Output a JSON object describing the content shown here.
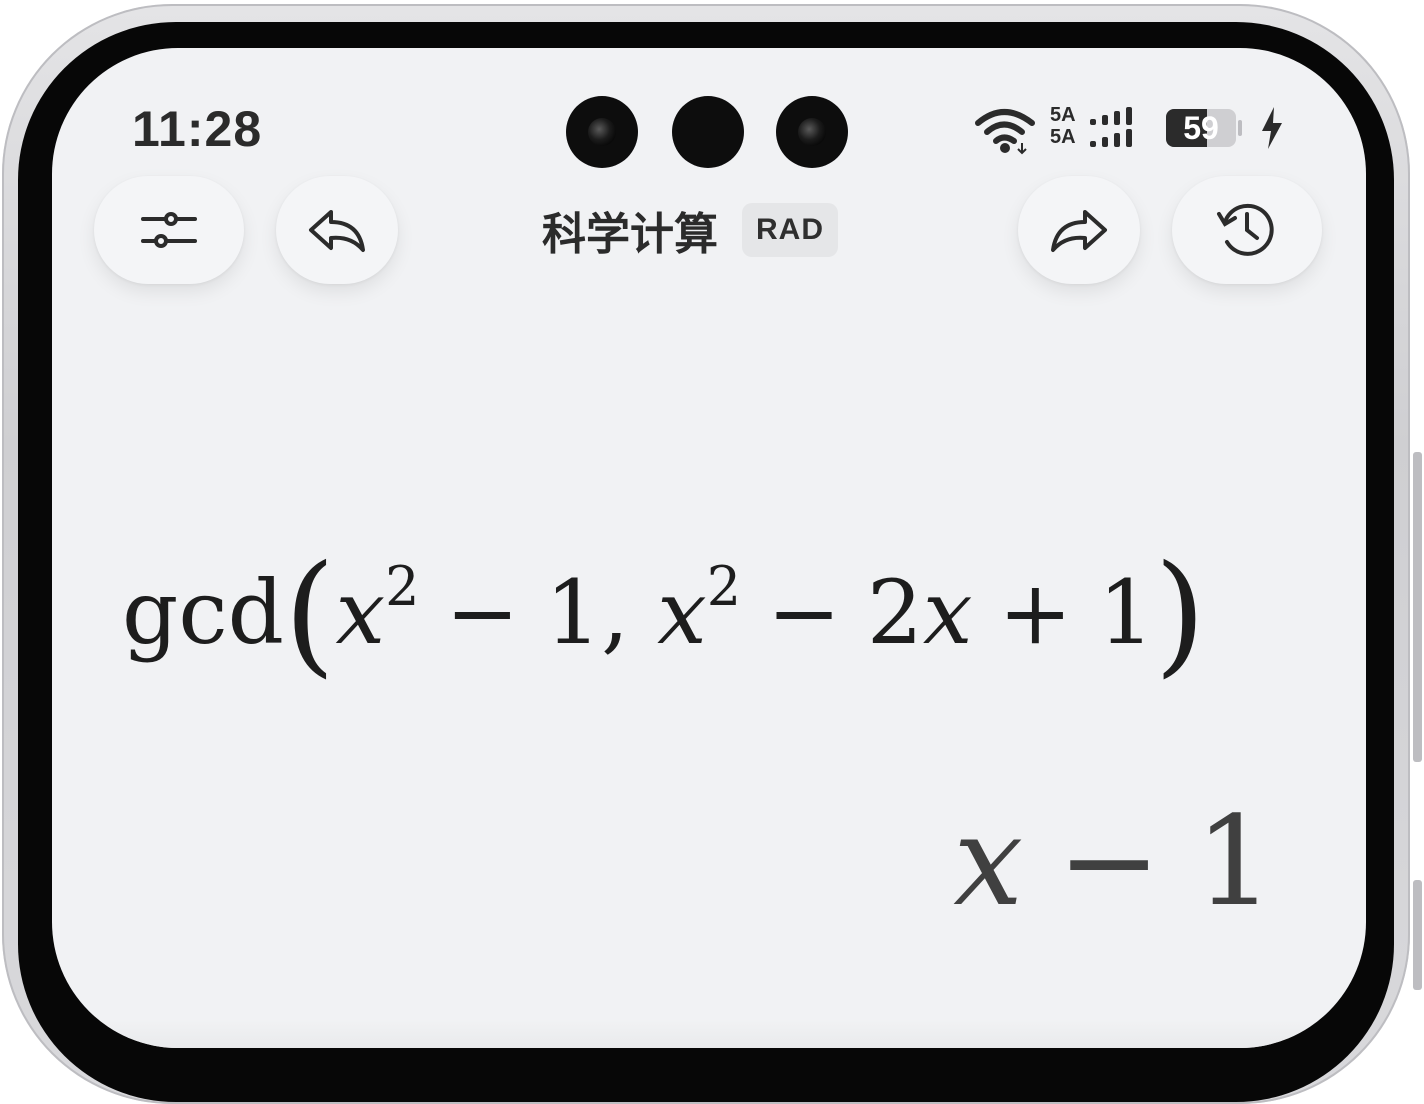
{
  "status_bar": {
    "time": "11:28",
    "network_top": "5A",
    "network_bottom": "5A",
    "battery_percent": "59",
    "battery_level": 0.59,
    "charging": true
  },
  "toolbar": {
    "title": "科学计算",
    "angle_mode": "RAD",
    "icons": [
      "sliders-icon",
      "undo-icon",
      "redo-icon",
      "history-icon"
    ]
  },
  "expression": {
    "function": "gcd",
    "open_paren": "(",
    "var1": "x",
    "exp1": "2",
    "minus1": "−",
    "const1": "1,",
    "var2": "x",
    "exp2": "2",
    "minus2": "−",
    "coef": "2",
    "var3": "x",
    "plus": "+",
    "const2": "1",
    "close_paren": ")"
  },
  "result": {
    "var": "x",
    "op": "−",
    "const": "1"
  },
  "colors": {
    "screen_bg": "#f1f2f4",
    "text": "#1d1d1d",
    "result_text": "#404040",
    "badge_bg": "#e5e6e8"
  }
}
